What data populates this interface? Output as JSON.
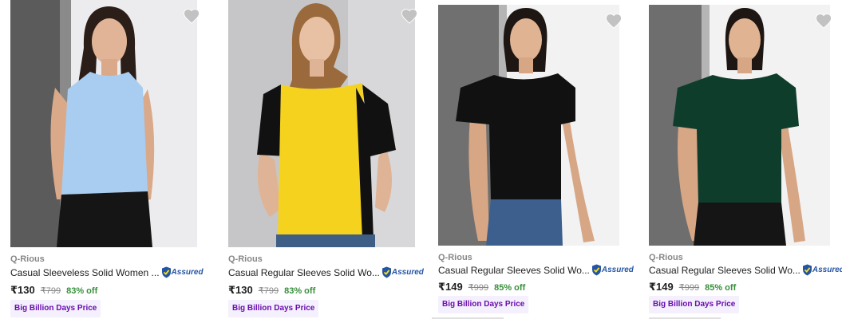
{
  "colors": {
    "accent": "#2455a4",
    "discount": "#388e3c",
    "tag_bg": "#f4f0fd",
    "tag_text": "#6a0dad",
    "muted": "#878787"
  },
  "products": [
    {
      "brand": "Q-Rious",
      "title": "Casual Sleeveless Solid Women ...",
      "assured_label": "Assured",
      "price": "₹130",
      "mrp": "₹799",
      "discount": "83% off",
      "tag": "Big Billion Days Price",
      "wishlist_icon": "heart-icon",
      "garment_color": "#a9cdf0"
    },
    {
      "brand": "Q-Rious",
      "title": "Casual Regular Sleeves Solid Wo...",
      "assured_label": "Assured",
      "price": "₹130",
      "mrp": "₹799",
      "discount": "83% off",
      "tag": "Big Billion Days Price",
      "wishlist_icon": "heart-icon",
      "garment_color": "#f5d21e"
    },
    {
      "brand": "Q-Rious",
      "title": "Casual Regular Sleeves Solid Wo...",
      "assured_label": "Assured",
      "price": "₹149",
      "mrp": "₹999",
      "discount": "85% off",
      "tag": "Big Billion Days Price",
      "wishlist_icon": "heart-icon",
      "garment_color": "#111111"
    },
    {
      "brand": "Q-Rious",
      "title": "Casual Regular Sleeves Solid Wo...",
      "assured_label": "Assured",
      "price": "₹149",
      "mrp": "₹999",
      "discount": "85% off",
      "tag": "Big Billion Days Price",
      "wishlist_icon": "heart-icon",
      "garment_color": "#0f3d2c"
    }
  ]
}
